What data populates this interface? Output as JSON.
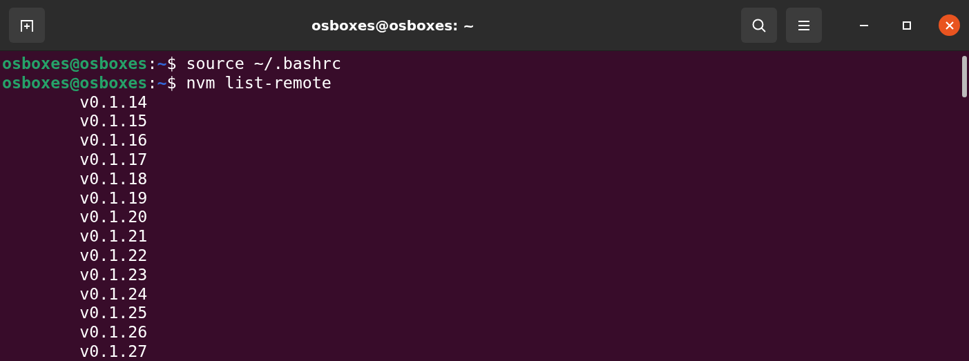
{
  "window": {
    "title": "osboxes@osboxes: ~"
  },
  "terminal": {
    "lines": [
      {
        "kind": "prompt",
        "user_host": "osboxes@osboxes",
        "colon": ":",
        "path": "~",
        "symbol": "$",
        "command": "source ~/.bashrc"
      },
      {
        "kind": "prompt",
        "user_host": "osboxes@osboxes",
        "colon": ":",
        "path": "~",
        "symbol": "$",
        "command": "nvm list-remote"
      },
      {
        "kind": "output",
        "text": "v0.1.14"
      },
      {
        "kind": "output",
        "text": "v0.1.15"
      },
      {
        "kind": "output",
        "text": "v0.1.16"
      },
      {
        "kind": "output",
        "text": "v0.1.17"
      },
      {
        "kind": "output",
        "text": "v0.1.18"
      },
      {
        "kind": "output",
        "text": "v0.1.19"
      },
      {
        "kind": "output",
        "text": "v0.1.20"
      },
      {
        "kind": "output",
        "text": "v0.1.21"
      },
      {
        "kind": "output",
        "text": "v0.1.22"
      },
      {
        "kind": "output",
        "text": "v0.1.23"
      },
      {
        "kind": "output",
        "text": "v0.1.24"
      },
      {
        "kind": "output",
        "text": "v0.1.25"
      },
      {
        "kind": "output",
        "text": "v0.1.26"
      },
      {
        "kind": "output",
        "text": "v0.1.27"
      }
    ]
  }
}
